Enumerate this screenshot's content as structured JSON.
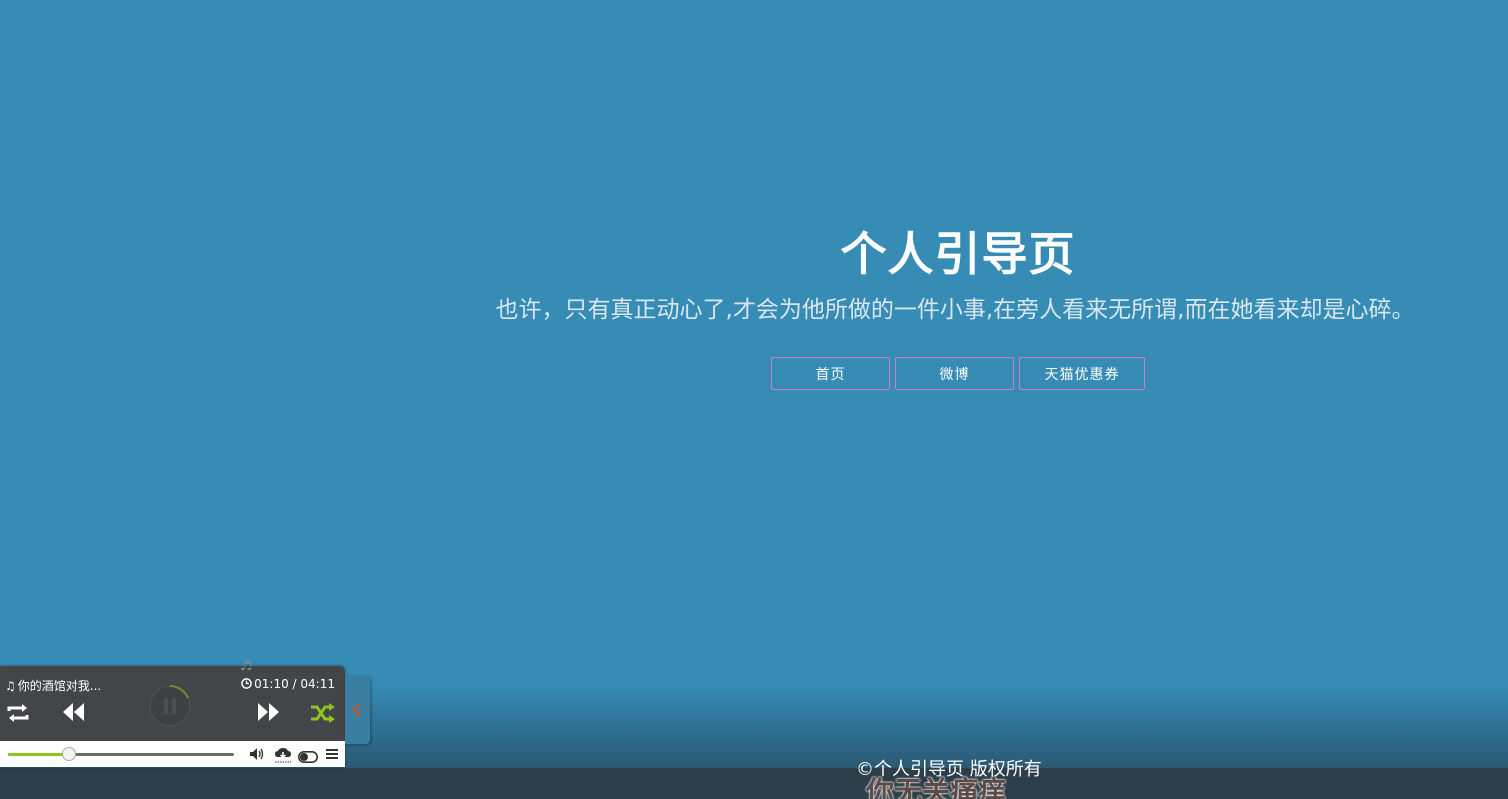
{
  "hero": {
    "title": "个人引导页",
    "subtitle": "也许，只有真正动心了,才会为他所做的一件小事,在旁人看来无所谓,而在她看来却是心碎。"
  },
  "nav": {
    "buttons": [
      "首页",
      "微博",
      "天猫优惠券"
    ],
    "border_color": "#c77fc8"
  },
  "footer": {
    "copyright": "©个人引导页 版权所有",
    "lyric": "你无关痛痒"
  },
  "player": {
    "song_title": "你的酒馆对我...",
    "time": "01:10 / 04:11",
    "progress_fraction": 0.27,
    "accent_color": "#8fc31f",
    "icons": [
      "music-note-icon",
      "clock-icon",
      "repeat-icon",
      "rewind-icon",
      "pause-icon",
      "fast-forward-icon",
      "shuffle-icon",
      "volume-icon",
      "download-icon",
      "toggle-icon",
      "menu-icon",
      "chevron-left-icon"
    ]
  },
  "colors": {
    "background": "#368cb4",
    "footer": "#2b3e49",
    "collapse_arrow": "#d2521e"
  }
}
